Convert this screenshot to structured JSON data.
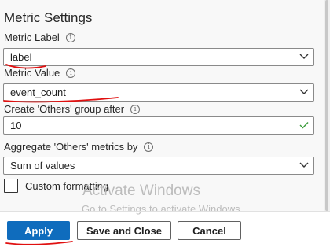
{
  "title": "Metric Settings",
  "metric_label": {
    "label": "Metric Label",
    "value": "label"
  },
  "metric_value": {
    "label": "Metric Value",
    "value": "event_count"
  },
  "others_group": {
    "label": "Create 'Others' group after",
    "value": "10"
  },
  "aggregate": {
    "label": "Aggregate 'Others' metrics by",
    "value": "Sum of values"
  },
  "custom_formatting": {
    "label": "Custom formatting",
    "checked": false
  },
  "watermark": {
    "title": "Activate Windows",
    "subtitle": "Go to Settings to activate Windows."
  },
  "buttons": {
    "apply": "Apply",
    "save_close": "Save and Close",
    "cancel": "Cancel"
  },
  "colors": {
    "primary": "#0f6cbd",
    "annotation": "#e01010",
    "valid": "#3a9b3a"
  },
  "icons": {
    "info": "info-icon",
    "dropdown": "chevron-down-icon",
    "valid": "checkmark-icon"
  }
}
